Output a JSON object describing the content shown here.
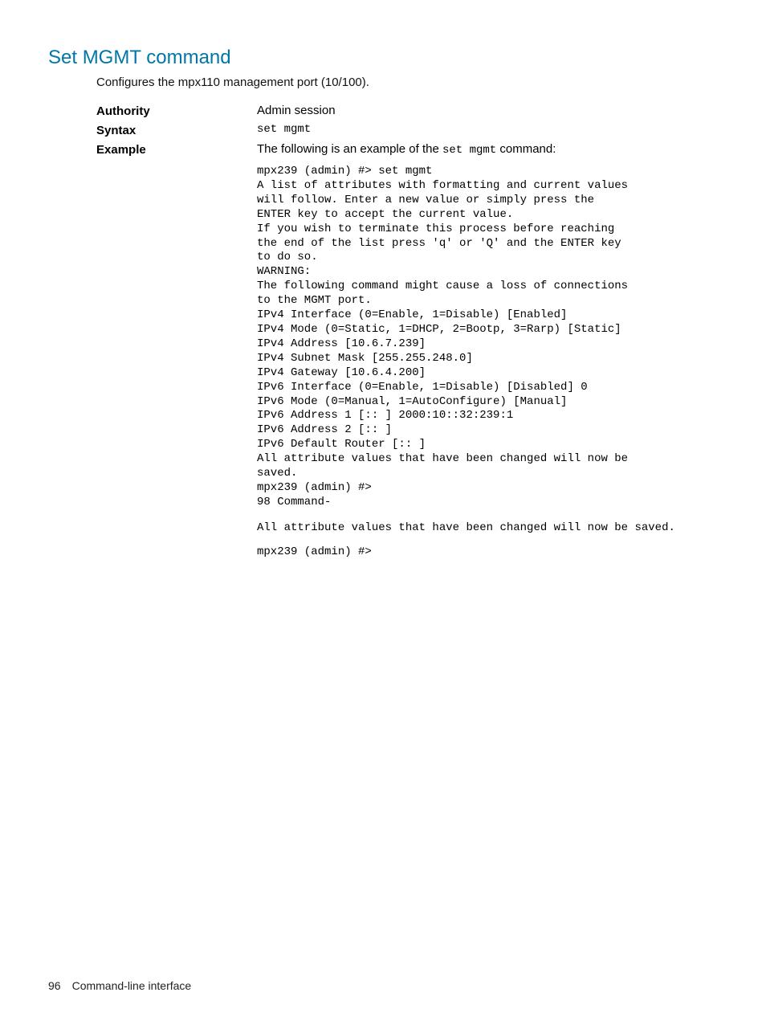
{
  "heading": "Set MGMT command",
  "intro": "Configures the mpx110 management port (10/100).",
  "authority": {
    "label": "Authority",
    "value": "Admin session"
  },
  "syntax": {
    "label": "Syntax",
    "value": "set mgmt"
  },
  "example": {
    "label": "Example",
    "intro_pre": "The following is an example of the ",
    "intro_cmd": "set mgmt",
    "intro_post": " command:",
    "block": "mpx239 (admin) #> set mgmt\nA list of attributes with formatting and current values\nwill follow. Enter a new value or simply press the\nENTER key to accept the current value.\nIf you wish to terminate this process before reaching\nthe end of the list press 'q' or 'Q' and the ENTER key\nto do so.\nWARNING:\nThe following command might cause a loss of connections\nto the MGMT port.\nIPv4 Interface (0=Enable, 1=Disable) [Enabled]\nIPv4 Mode (0=Static, 1=DHCP, 2=Bootp, 3=Rarp) [Static]\nIPv4 Address [10.6.7.239]\nIPv4 Subnet Mask [255.255.248.0]\nIPv4 Gateway [10.6.4.200]\nIPv6 Interface (0=Enable, 1=Disable) [Disabled] 0\nIPv6 Mode (0=Manual, 1=AutoConfigure) [Manual]\nIPv6 Address 1 [:: ] 2000:10::32:239:1\nIPv6 Address 2 [:: ]\nIPv6 Default Router [:: ]\nAll attribute values that have been changed will now be\nsaved.\nmpx239 (admin) #>\n98 Command-",
    "after": "All attribute values that have been changed will now be saved.",
    "prompt": "mpx239 (admin) #>"
  },
  "footer": {
    "page": "96",
    "section": "Command-line interface"
  }
}
